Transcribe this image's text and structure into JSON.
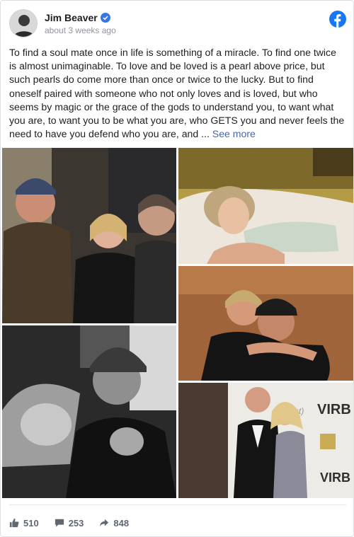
{
  "post": {
    "author": "Jim Beaver",
    "timestamp": "about 3 weeks ago",
    "text": "To find a soul mate once in life is something of a miracle. To find one twice is almost unimaginable. To love and be loved is a pearl above price, but such pearls do come more than once or twice to the lucky. But to find oneself paired with someone who not only loves and is loved, but who seems by magic or the grace of the gods to understand you, to want what you are, to want you to be what you are, who GETS you and never feels the need to have you defend who you are, and ... ",
    "see_more_label": "See more"
  },
  "icons": {
    "verified": "verified-check-icon",
    "platform": "facebook-icon",
    "like": "thumbs-up-icon",
    "comment": "comment-icon",
    "share": "share-icon"
  },
  "stats": {
    "likes": "510",
    "comments": "253",
    "shares": "848"
  },
  "colors": {
    "link": "#4267b2",
    "facebook_blue": "#1877f2",
    "verified_blue": "#3578e5"
  }
}
